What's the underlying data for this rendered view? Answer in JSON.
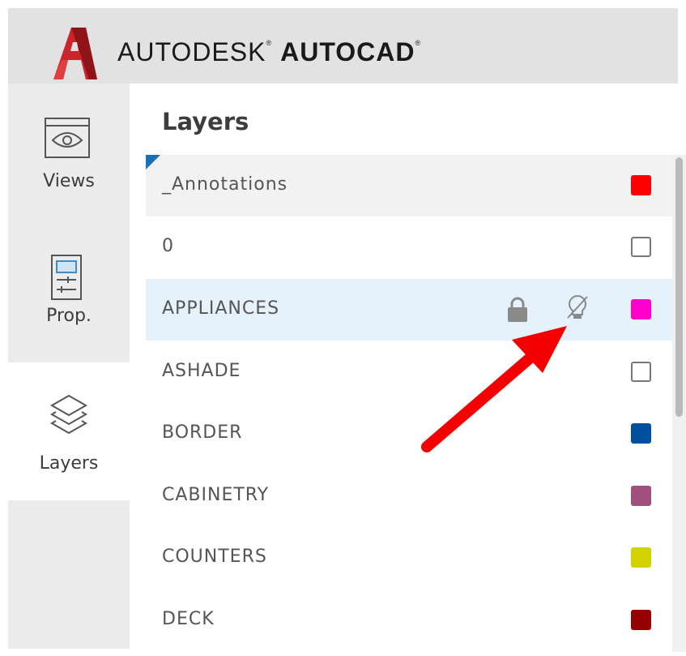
{
  "header": {
    "brand_prefix": "AUTODESK",
    "brand_product": "AUTOCAD",
    "logo_icon": "autocad-logo-a",
    "logo_color": "#d0262b"
  },
  "rail": {
    "items": [
      {
        "label": "Views",
        "icon": "eye-icon"
      },
      {
        "label": "Prop.",
        "icon": "properties-icon"
      },
      {
        "label": "Layers",
        "icon": "layers-icon",
        "active": true
      }
    ]
  },
  "panel": {
    "title": "Layers"
  },
  "layers": [
    {
      "name": "_Annotations",
      "color": "#ff0000"
    },
    {
      "name": "0",
      "color": "#ffffff"
    },
    {
      "name": "APPLIANCES",
      "color": "#ff00cc",
      "selected": true,
      "icons": [
        "lock-icon",
        "bulb-off-icon"
      ]
    },
    {
      "name": "ASHADE",
      "color": "#ffffff"
    },
    {
      "name": "BORDER",
      "color": "#0050a0"
    },
    {
      "name": "CABINETRY",
      "color": "#a0507a"
    },
    {
      "name": "COUNTERS",
      "color": "#d2d200"
    },
    {
      "name": "DECK",
      "color": "#960000"
    }
  ],
  "annotation": {
    "arrow_color": "#ff0000"
  }
}
